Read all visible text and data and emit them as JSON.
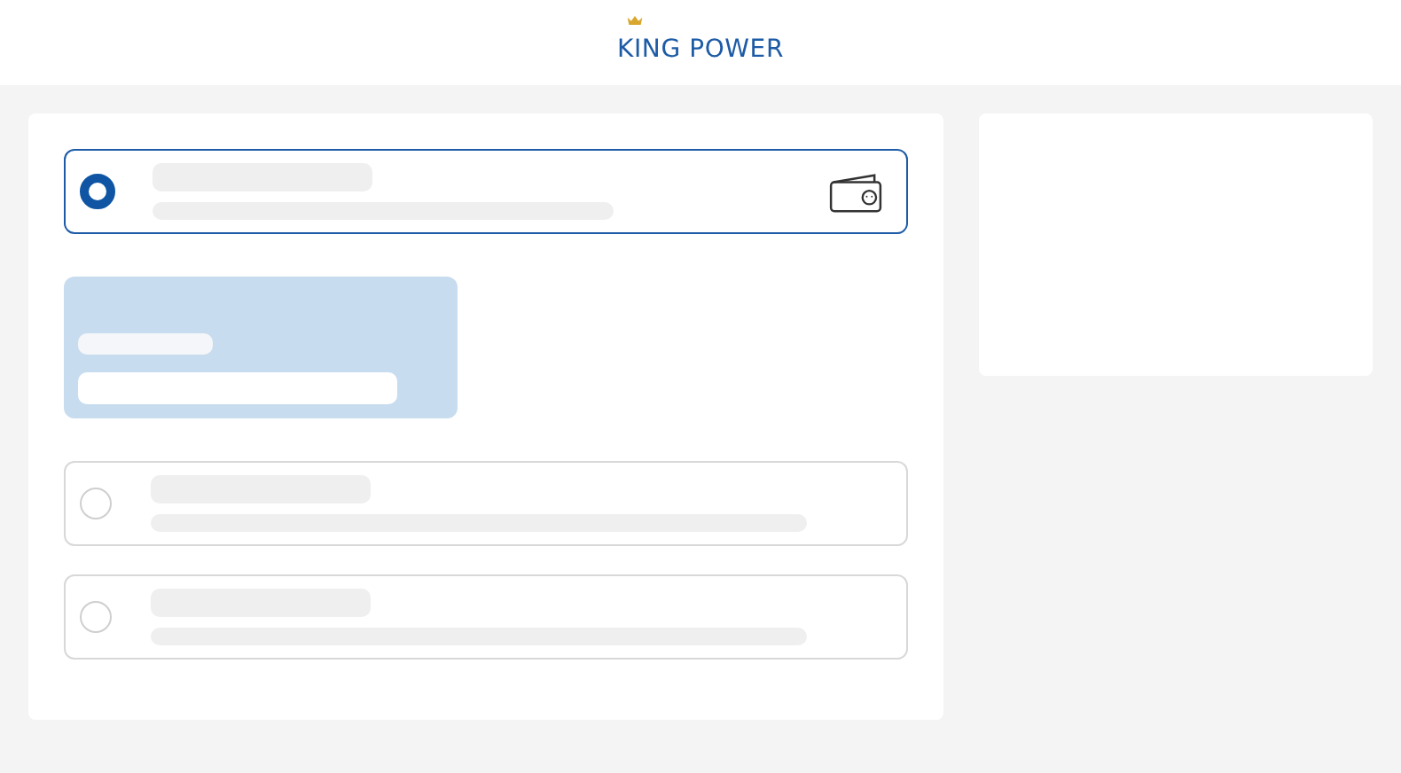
{
  "header": {
    "logo": "KING POWER"
  },
  "payment_options": [
    {
      "kind": "wallet",
      "selected": true
    },
    {
      "kind": "plain",
      "selected": false
    },
    {
      "kind": "plain",
      "selected": false
    }
  ]
}
